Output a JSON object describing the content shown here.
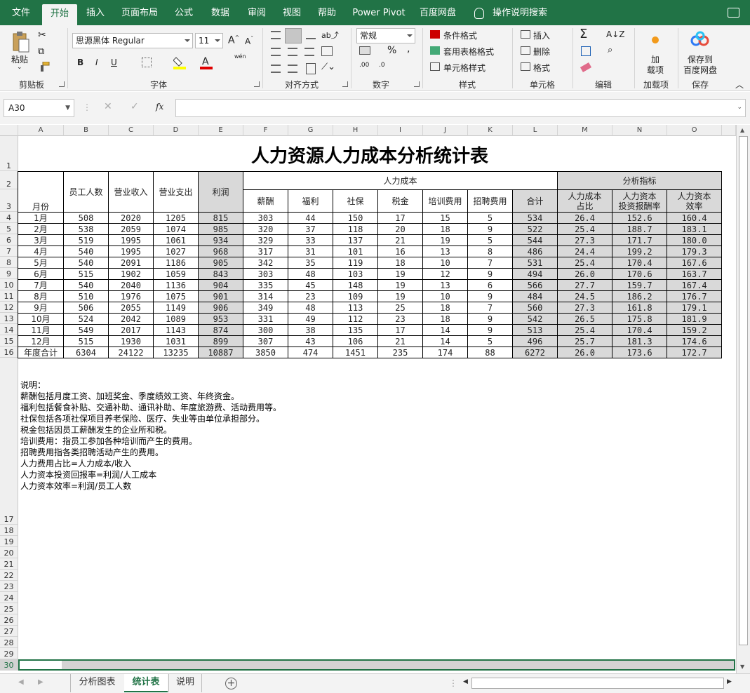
{
  "ribbon_tabs": [
    "文件",
    "开始",
    "插入",
    "页面布局",
    "公式",
    "数据",
    "审阅",
    "视图",
    "帮助",
    "Power Pivot",
    "百度网盘"
  ],
  "tell_me": "操作说明搜索",
  "ribbon": {
    "paste": "粘贴",
    "clipboard": "剪贴板",
    "font_name": "思源黑体 Regular",
    "font_size": "11",
    "font_group": "字体",
    "align_group": "对齐方式",
    "number_format": "常规",
    "number_group": "数字",
    "cond_format": "条件格式",
    "table_format": "套用表格格式",
    "cell_style": "单元格样式",
    "styles_group": "样式",
    "insert": "插入",
    "delete": "删除",
    "format": "格式",
    "cells_group": "单元格",
    "edit_group": "编辑",
    "addin_btn1": "加",
    "addin_btn2": "载项",
    "addin_group": "加载项",
    "save_btn1": "保存到",
    "save_btn2": "百度网盘",
    "save_group": "保存",
    "bold": "B",
    "italic": "I",
    "underline": "U",
    "wen": "wén",
    "percent": "%"
  },
  "namebox": "A30",
  "fx": "fx",
  "col_headers": [
    "A",
    "B",
    "C",
    "D",
    "E",
    "F",
    "G",
    "H",
    "I",
    "J",
    "K",
    "L",
    "M",
    "N",
    "O"
  ],
  "row_headers": [
    "1",
    "2",
    "3",
    "4",
    "5",
    "6",
    "7",
    "8",
    "9",
    "10",
    "11",
    "12",
    "13",
    "14",
    "15",
    "16",
    "17",
    "18",
    "19",
    "20",
    "21",
    "22",
    "23",
    "24",
    "25",
    "26",
    "27",
    "28",
    "29",
    "30"
  ],
  "title": "人力资源人力成本分析统计表",
  "headers": {
    "month": "月份",
    "employees": "员工人数",
    "revenue": "营业收入",
    "expense": "营业支出",
    "profit": "利润",
    "hr_cost": "人力成本",
    "salary": "薪酬",
    "welfare": "福利",
    "social": "社保",
    "tax": "税金",
    "training": "培训费用",
    "recruit": "招聘费用",
    "total": "合计",
    "analysis": "分析指标",
    "ratio_a": "人力成本",
    "ratio_b": "占比",
    "roi_a": "人力资本",
    "roi_b": "投资报酬率",
    "eff_a": "人力资本",
    "eff_b": "效率"
  },
  "rows": [
    [
      "1月",
      "508",
      "2020",
      "1205",
      "815",
      "303",
      "44",
      "150",
      "17",
      "15",
      "5",
      "534",
      "26.4",
      "152.6",
      "160.4"
    ],
    [
      "2月",
      "538",
      "2059",
      "1074",
      "985",
      "320",
      "37",
      "118",
      "20",
      "18",
      "9",
      "522",
      "25.4",
      "188.7",
      "183.1"
    ],
    [
      "3月",
      "519",
      "1995",
      "1061",
      "934",
      "329",
      "33",
      "137",
      "21",
      "19",
      "5",
      "544",
      "27.3",
      "171.7",
      "180.0"
    ],
    [
      "4月",
      "540",
      "1995",
      "1027",
      "968",
      "317",
      "31",
      "101",
      "16",
      "13",
      "8",
      "486",
      "24.4",
      "199.2",
      "179.3"
    ],
    [
      "5月",
      "540",
      "2091",
      "1186",
      "905",
      "342",
      "35",
      "119",
      "18",
      "10",
      "7",
      "531",
      "25.4",
      "170.4",
      "167.6"
    ],
    [
      "6月",
      "515",
      "1902",
      "1059",
      "843",
      "303",
      "48",
      "103",
      "19",
      "12",
      "9",
      "494",
      "26.0",
      "170.6",
      "163.7"
    ],
    [
      "7月",
      "540",
      "2040",
      "1136",
      "904",
      "335",
      "45",
      "148",
      "19",
      "13",
      "6",
      "566",
      "27.7",
      "159.7",
      "167.4"
    ],
    [
      "8月",
      "510",
      "1976",
      "1075",
      "901",
      "314",
      "23",
      "109",
      "19",
      "10",
      "9",
      "484",
      "24.5",
      "186.2",
      "176.7"
    ],
    [
      "9月",
      "506",
      "2055",
      "1149",
      "906",
      "349",
      "48",
      "113",
      "25",
      "18",
      "7",
      "560",
      "27.3",
      "161.8",
      "179.1"
    ],
    [
      "10月",
      "524",
      "2042",
      "1089",
      "953",
      "331",
      "49",
      "112",
      "23",
      "18",
      "9",
      "542",
      "26.5",
      "175.8",
      "181.9"
    ],
    [
      "11月",
      "549",
      "2017",
      "1143",
      "874",
      "300",
      "38",
      "135",
      "17",
      "14",
      "9",
      "513",
      "25.4",
      "170.4",
      "159.2"
    ],
    [
      "12月",
      "515",
      "1930",
      "1031",
      "899",
      "307",
      "43",
      "106",
      "21",
      "14",
      "5",
      "496",
      "25.7",
      "181.3",
      "174.6"
    ],
    [
      "年度合计",
      "6304",
      "24122",
      "13235",
      "10887",
      "3850",
      "474",
      "1451",
      "235",
      "174",
      "88",
      "6272",
      "26.0",
      "173.6",
      "172.7"
    ]
  ],
  "notes": [
    "说明：",
    "薪酬包括月度工资、加班奖金、季度绩效工资、年终资金。",
    "福利包括餐食补贴、交通补助、通讯补助、年度旅游费、活动费用等。",
    "社保包括各项社保项目养老保险、医疗、失业等由单位承担部分。",
    "税金包括因员工薪酬发生的企业所和税。",
    "培训费用：指员工参加各种培训而产生的费用。",
    "招聘费用指各类招聘活动产生的费用。",
    "人力费用占比=人力成本/收入",
    "人力资本投资回报率=利润/人工成本",
    "人力资本效率=利润/员工人数"
  ],
  "sheet_tabs": [
    "分析图表",
    "统计表",
    "说明"
  ],
  "colors": {
    "accent": "#217346",
    "gray_fill": "#d9d9d9"
  }
}
